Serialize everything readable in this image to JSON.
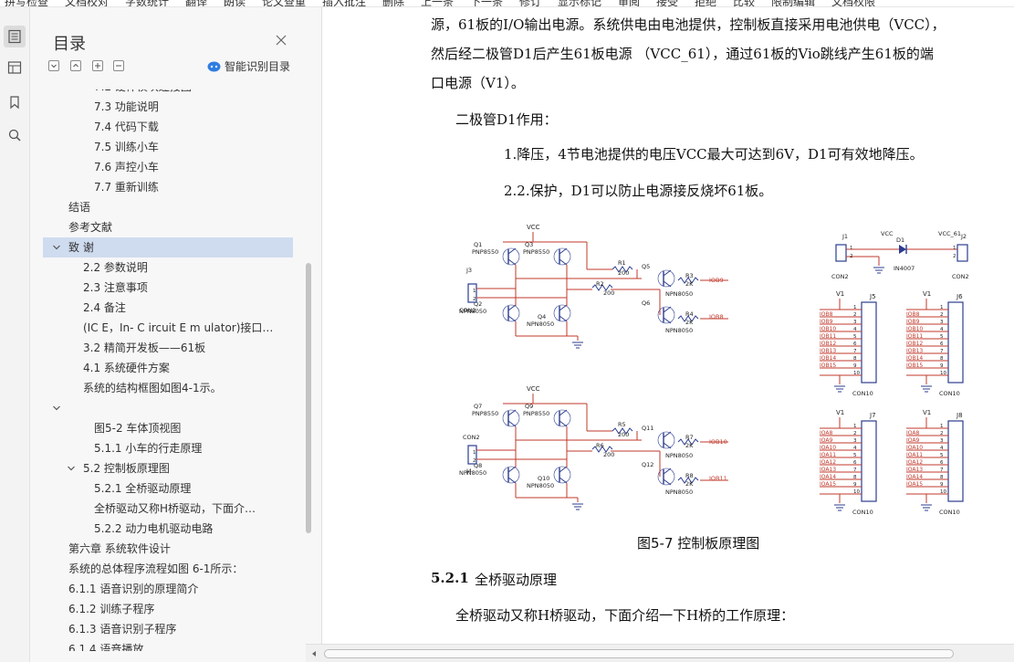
{
  "toolbar": {
    "items": [
      "拼写检查",
      "文档校对",
      "字数统计",
      "翻译",
      "朗读",
      "论文查重",
      "插入批注",
      "删除",
      "上一条",
      "下一条",
      "修订",
      "显示标记",
      "审阅",
      "接受",
      "拒绝",
      "比较",
      "限制编辑",
      "文档权限"
    ]
  },
  "rail": {
    "icons": [
      "toc-icon",
      "nav-icon",
      "bookmark-icon",
      "search-icon"
    ]
  },
  "toc": {
    "title": "目录",
    "smart_label": "智能识别目录",
    "items": [
      {
        "text": "7.2  硬件模块连接图",
        "indent": 2
      },
      {
        "text": "7.3  功能说明",
        "indent": 2
      },
      {
        "text": "7.4  代码下载",
        "indent": 2
      },
      {
        "text": "7.5  训练小车",
        "indent": 2
      },
      {
        "text": "7.6  声控小车",
        "indent": 2
      },
      {
        "text": "7.7  重新训练",
        "indent": 2
      },
      {
        "text": "结语",
        "indent": 0
      },
      {
        "text": "参考文献",
        "indent": 0
      },
      {
        "text": "致  谢",
        "indent": 0,
        "expanded": true,
        "selected": true
      },
      {
        "text": "2.2  参数说明",
        "indent": 1
      },
      {
        "text": "2.3  注意事项",
        "indent": 1
      },
      {
        "text": "2.4  备注",
        "indent": 1
      },
      {
        "text": "(IC E，In- C ircuit E m ulator)接口…",
        "indent": 1
      },
      {
        "text": "3.2  精简开发板——61板",
        "indent": 1
      },
      {
        "text": "4.1  系统硬件方案",
        "indent": 1
      },
      {
        "text": "系统的结构框图如图4-1示。",
        "indent": 1
      },
      {
        "text": "",
        "indent": 0,
        "expanded": true
      },
      {
        "text": "图5-2  车体顶视图",
        "indent": 2
      },
      {
        "text": "5.1.1  小车的行走原理",
        "indent": 2
      },
      {
        "text": "5.2  控制板原理图",
        "indent": 1,
        "expanded": true
      },
      {
        "text": "5.2.1  全桥驱动原理",
        "indent": 2
      },
      {
        "text": "全桥驱动又称H桥驱动，下面介…",
        "indent": 2
      },
      {
        "text": "5.2.2  动力电机驱动电路",
        "indent": 2
      },
      {
        "text": "第六章  系统软件设计",
        "indent": 0
      },
      {
        "text": "系统的总体程序流程如图 6-1所示：",
        "indent": 0
      },
      {
        "text": "6.1.1  语音识别的原理简介",
        "indent": 0
      },
      {
        "text": "6.1.2  训练子程序",
        "indent": 0
      },
      {
        "text": "6.1.3  语音识别子程序",
        "indent": 0
      },
      {
        "text": "6.1.4  语音播放",
        "indent": 0
      }
    ]
  },
  "doc": {
    "line1": "源，61板的I/O输出电源。系统供电由电池提供，控制板直接采用电池供电（VCC），",
    "line2": "然后经二极管D1后产生61板电源 （VCC_61），通过61板的Vio跳线产生61板的端",
    "line3": "口电源（V1）。",
    "line4": "二极管D1作用：",
    "item1": "1.降压，4节电池提供的电压VCC最大可达到6V，D1可有效地降压。",
    "item2": "2.2.保护，D1可以防止电源接反烧坏61板。",
    "figure_caption": "图5-7    控制板原理图",
    "section_num": "5.2.1",
    "section_title": "全桥驱动原理",
    "para": "全桥驱动又称H桥驱动，下面介绍一下H桥的工作原理："
  },
  "circuit": {
    "vcc": "VCC",
    "top": {
      "conn": "J3",
      "conn_type": "CON2",
      "q1": "Q1",
      "q3": "Q3",
      "q2": "Q2",
      "q4": "Q4",
      "q5": "Q5",
      "q6": "Q6",
      "pnp": "PNP8550",
      "npn": "NPN8050",
      "r1": "R1",
      "r2": "R2",
      "r3": "R3",
      "r4": "R4",
      "r200": "200",
      "r2k": "2K",
      "io_a": "IOB9",
      "io_b": "IOB8"
    },
    "bottom": {
      "conn": "J4",
      "conn_type": "CON2",
      "q7": "Q7",
      "q9": "Q9",
      "q8": "Q8",
      "q10": "Q10",
      "q11": "Q11",
      "q12": "Q12",
      "pnp": "PNP8550",
      "npn": "NPN8050",
      "r5": "R5",
      "r6": "R6",
      "r7": "R7",
      "r8": "R8",
      "r200": "200",
      "r2k": "2K",
      "io_a": "IOB10",
      "io_b": "IOB11"
    },
    "power": {
      "j1": "J1",
      "j2": "J2",
      "vcc": "VCC",
      "vcc61": "VCC_61",
      "d1": "D1",
      "diode": "IN4007",
      "con2": "CON2"
    },
    "headers": [
      {
        "ref": "J5",
        "v": "V1",
        "type": "CON10",
        "pins": [
          "IOB8",
          "IOB9",
          "IOB10",
          "IOB11",
          "IOB12",
          "IOB13",
          "IOB14",
          "IOB15"
        ]
      },
      {
        "ref": "J6",
        "v": "V1",
        "type": "CON10",
        "pins": [
          "IOB8",
          "IOB9",
          "IOB10",
          "IOB11",
          "IOB12",
          "IOB13",
          "IOB14",
          "IOB15"
        ]
      },
      {
        "ref": "J7",
        "v": "V1",
        "type": "CON10",
        "pins": [
          "IOA8",
          "IOA9",
          "IOA10",
          "IOA11",
          "IOA12",
          "IOA13",
          "IOA14",
          "IOA15"
        ]
      },
      {
        "ref": "J8",
        "v": "V1",
        "type": "CON10",
        "pins": [
          "IOA8",
          "IOA9",
          "IOA10",
          "IOA11",
          "IOA12",
          "IOA13",
          "IOA14",
          "IOA15"
        ]
      }
    ]
  }
}
